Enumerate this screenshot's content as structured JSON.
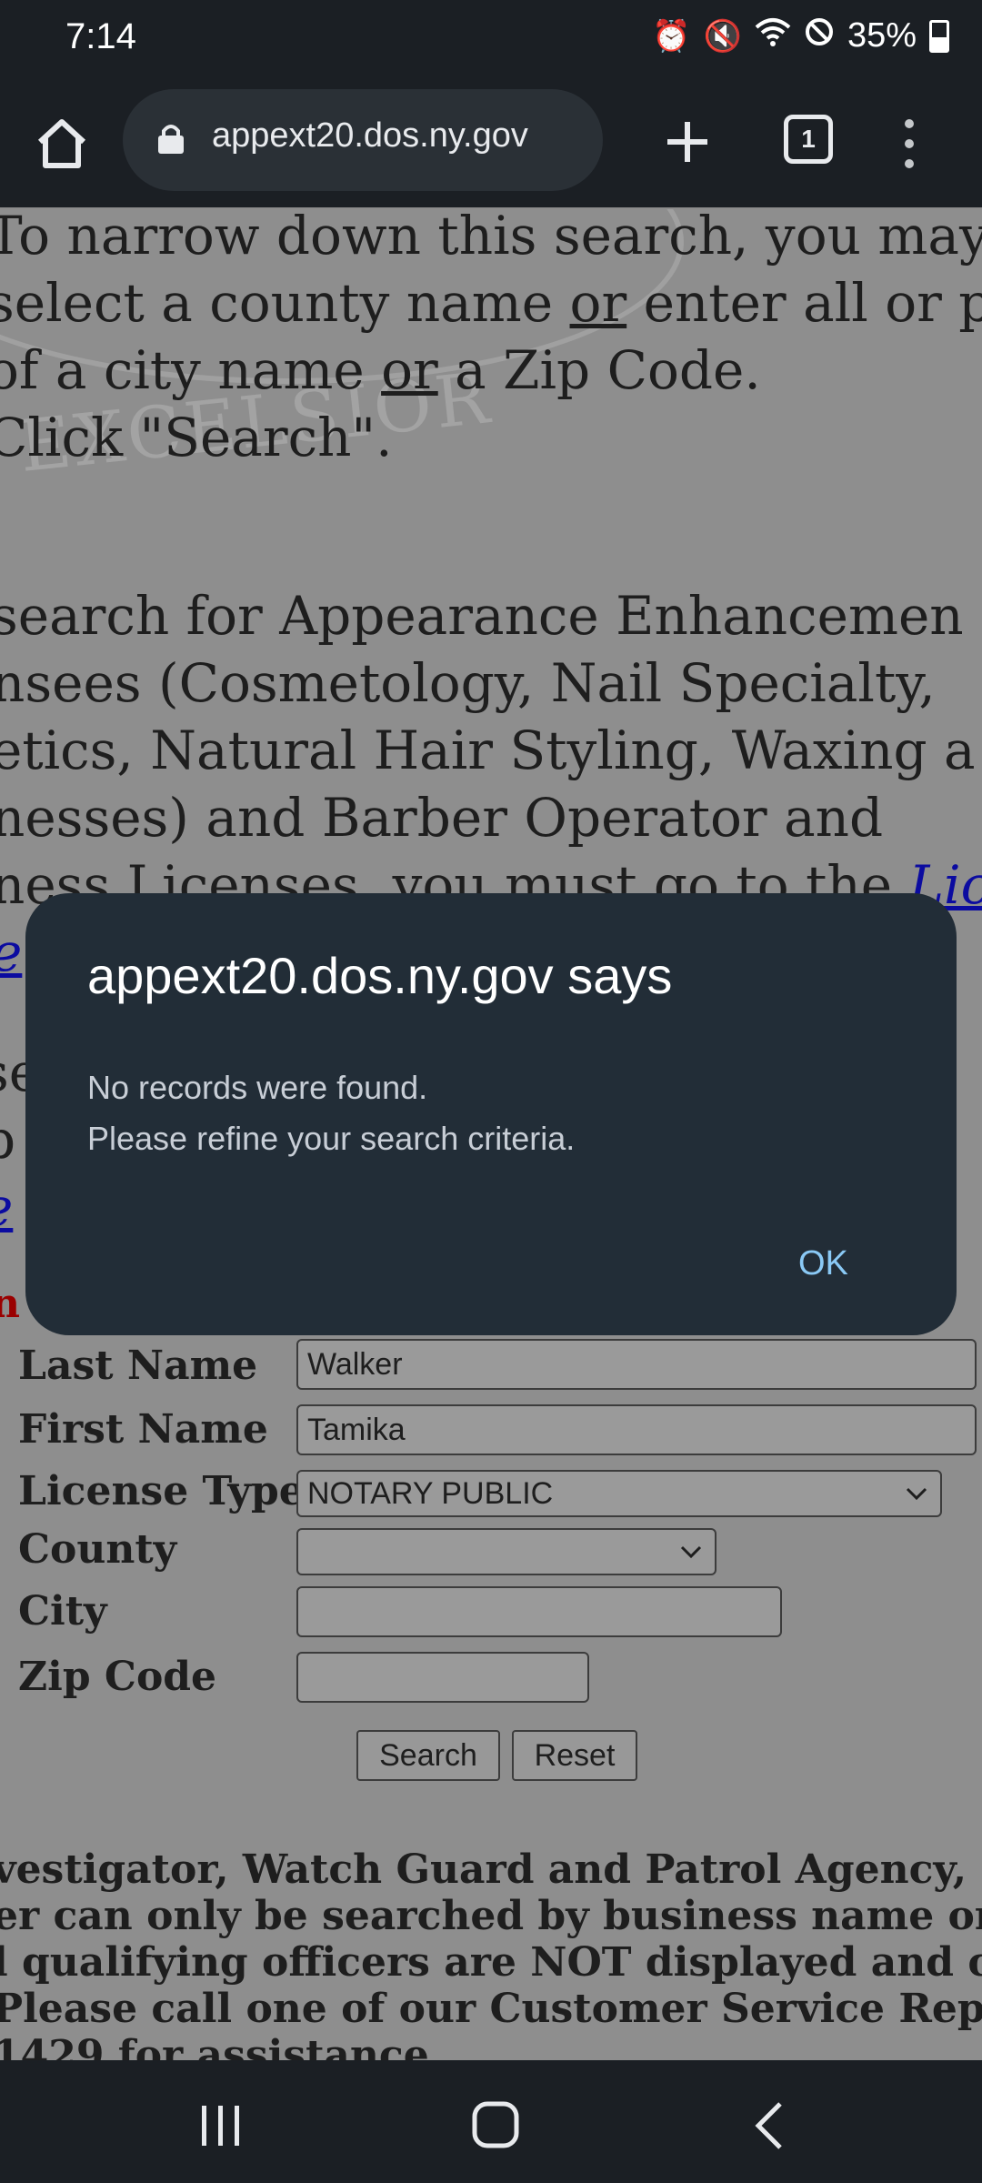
{
  "status_bar": {
    "time": "7:14",
    "battery": "35%",
    "icons": [
      "alarm-icon",
      "mute-icon",
      "wifi-icon",
      "dnd-icon",
      "battery-icon"
    ]
  },
  "browser": {
    "url": "appext20.dos.ny.gov",
    "tab_count": "1",
    "load_progress": 0.7
  },
  "page": {
    "intro": {
      "l1": "To narrow down this search, you may",
      "l2a": "select a county name ",
      "l2b": "or",
      "l2c": " enter all or p",
      "l3a": "of a city name ",
      "l3b": "or",
      "l3c": " a Zip Code.",
      "l4": "Click \"Search\"."
    },
    "info": {
      "l1": "search for Appearance Enhancemen",
      "l2": "nsees (Cosmetology, Nail Specialty,",
      "l3": "etics, Natural Hair Styling, Waxing a",
      "l4": "nesses) and Barber Operator and",
      "l5a": "ness Licenses, you must go to the ",
      "l5b": "Lic",
      "l6": "e"
    },
    "partial": {
      "l1": "se",
      "l2": "p",
      "l3": "e"
    },
    "red_line": "n c                                                                                  n C",
    "watermark": "EXCELSIOR",
    "form": {
      "last_name_label": "Last Name",
      "last_name_value": "Walker",
      "first_name_label": "First Name",
      "first_name_value": "Tamika",
      "license_type_label": "License Type",
      "license_type_value": "NOTARY PUBLIC",
      "county_label": "County",
      "county_value": "",
      "city_label": "City",
      "city_value": "",
      "zip_label": "Zip Code",
      "zip_value": "",
      "search_button": "Search",
      "reset_button": "Reset"
    },
    "footer": {
      "l1": "vestigator, Watch Guard and Patrol Agency, and A",
      "l2": "er can only be searched by business name or UID#",
      "l3": "l qualifying officers are NOT displayed and canno",
      "l4": " Please call one of our Customer Service Represen",
      "l5": "1429 for assistance."
    }
  },
  "dialog": {
    "title": "appext20.dos.ny.gov says",
    "message_line1": "No records were found.",
    "message_line2": "Please refine your search criteria.",
    "ok_button": "OK"
  },
  "colors": {
    "dialog_bg": "#222d37",
    "ok_accent": "#8ac9f5",
    "link": "#0b0ba0",
    "progress": "#7cc7f5"
  }
}
